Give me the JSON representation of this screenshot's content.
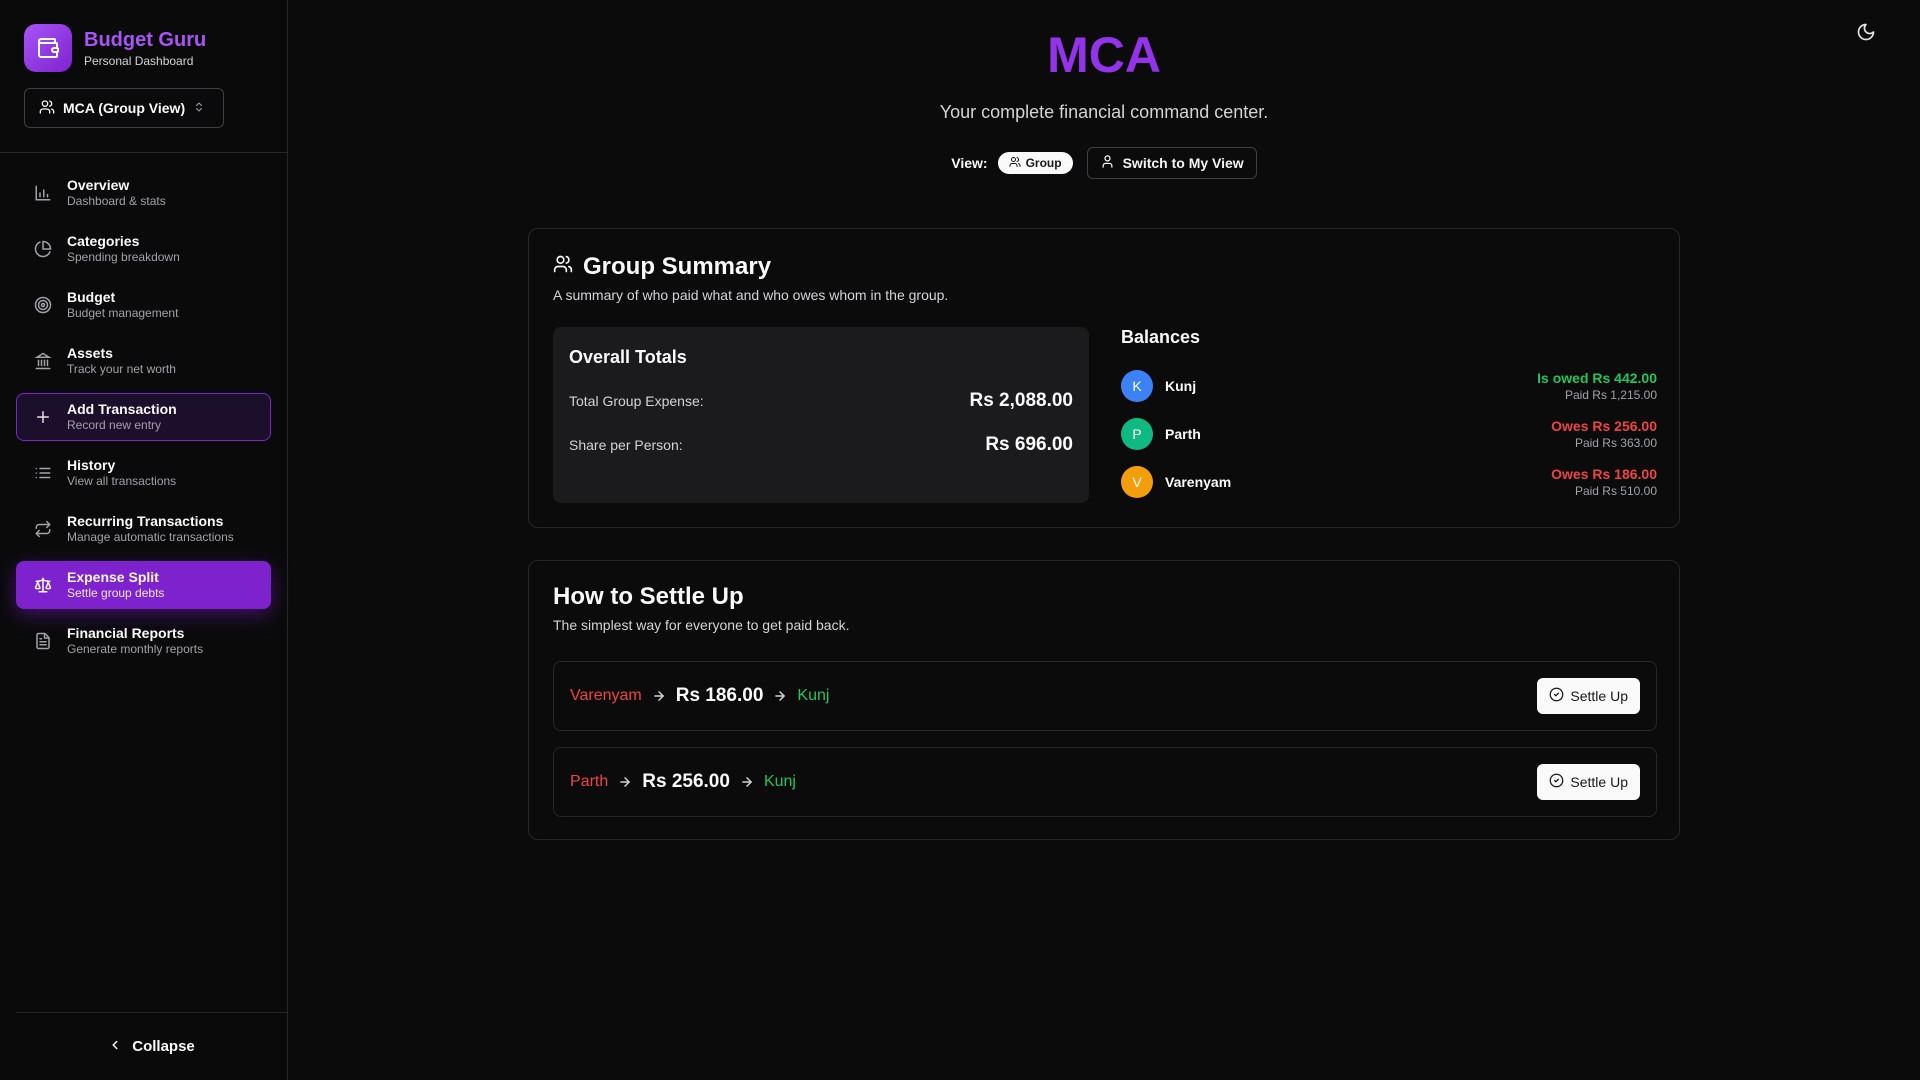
{
  "brand": {
    "title": "Budget Guru",
    "subtitle": "Personal Dashboard"
  },
  "group_selector": {
    "label": "MCA (Group View)"
  },
  "nav": [
    {
      "label": "Overview",
      "sub": "Dashboard & stats",
      "icon": "bar-chart-icon"
    },
    {
      "label": "Categories",
      "sub": "Spending breakdown",
      "icon": "pie-chart-icon"
    },
    {
      "label": "Budget",
      "sub": "Budget management",
      "icon": "target-icon"
    },
    {
      "label": "Assets",
      "sub": "Track your net worth",
      "icon": "bank-icon"
    },
    {
      "label": "Add Transaction",
      "sub": "Record new entry",
      "icon": "plus-icon"
    },
    {
      "label": "History",
      "sub": "View all transactions",
      "icon": "list-icon"
    },
    {
      "label": "Recurring Transactions",
      "sub": "Manage automatic transactions",
      "icon": "repeat-icon"
    },
    {
      "label": "Expense Split",
      "sub": "Settle group debts",
      "icon": "scale-icon"
    },
    {
      "label": "Financial Reports",
      "sub": "Generate monthly reports",
      "icon": "file-text-icon"
    }
  ],
  "collapse_label": "Collapse",
  "header": {
    "title": "MCA",
    "subtitle": "Your complete financial command center.",
    "view_label": "View:",
    "view_pill": "Group",
    "switch_label": "Switch to My View"
  },
  "summary": {
    "title": "Group Summary",
    "description": "A summary of who paid what and who owes whom in the group.",
    "totals": {
      "title": "Overall Totals",
      "rows": [
        {
          "label": "Total Group Expense:",
          "value": "Rs 2,088.00"
        },
        {
          "label": "Share per Person:",
          "value": "Rs 696.00"
        }
      ]
    },
    "balances": {
      "title": "Balances",
      "people": [
        {
          "initial": "K",
          "name": "Kunj",
          "status": "Is owed Rs 442.00",
          "paid": "Paid Rs 1,215.00",
          "avatar_color": "#3b82f6",
          "tone": "green"
        },
        {
          "initial": "P",
          "name": "Parth",
          "status": "Owes Rs 256.00",
          "paid": "Paid Rs 363.00",
          "avatar_color": "#10b981",
          "tone": "red"
        },
        {
          "initial": "V",
          "name": "Varenyam",
          "status": "Owes Rs 186.00",
          "paid": "Paid Rs 510.00",
          "avatar_color": "#f59e0b",
          "tone": "red"
        }
      ]
    }
  },
  "settle": {
    "title": "How to Settle Up",
    "description": "The simplest way for everyone to get paid back.",
    "rows": [
      {
        "from": "Varenyam",
        "amount": "Rs 186.00",
        "to": "Kunj",
        "button": "Settle Up"
      },
      {
        "from": "Parth",
        "amount": "Rs 256.00",
        "to": "Kunj",
        "button": "Settle Up"
      }
    ]
  },
  "colors": {
    "accent": "#9333ea",
    "positive": "#22c55e",
    "negative": "#ef4444"
  }
}
